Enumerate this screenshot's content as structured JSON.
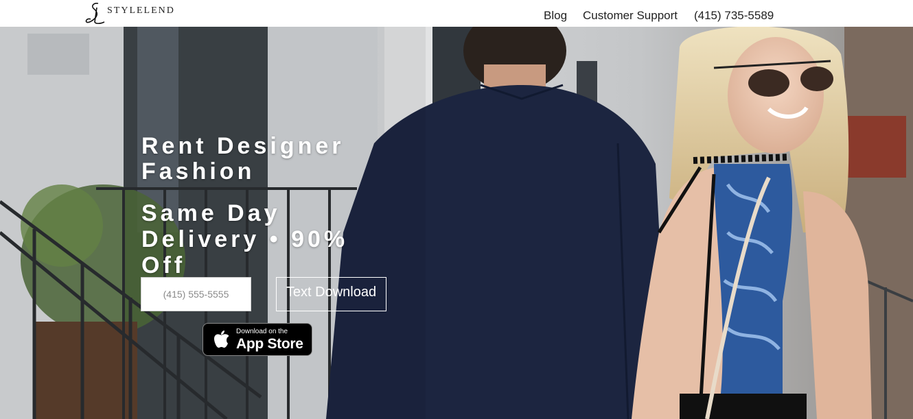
{
  "header": {
    "logo_text": "STYLELEND",
    "nav": {
      "blog": "Blog",
      "support": "Customer Support",
      "phone": "(415) 735-5589"
    }
  },
  "hero": {
    "headline": "Rent Designer Fashion",
    "subheadline": "Same Day Delivery • 90% Off",
    "phone_placeholder": "(415) 555-5555",
    "text_button": "Text Download",
    "appstore": {
      "small": "Download on the",
      "big": "App Store"
    }
  },
  "colors": {
    "text_dark": "#222222",
    "hero_text": "#ffffff",
    "jacket": "#1c2540",
    "dress_blue": "#2d5a9e"
  }
}
